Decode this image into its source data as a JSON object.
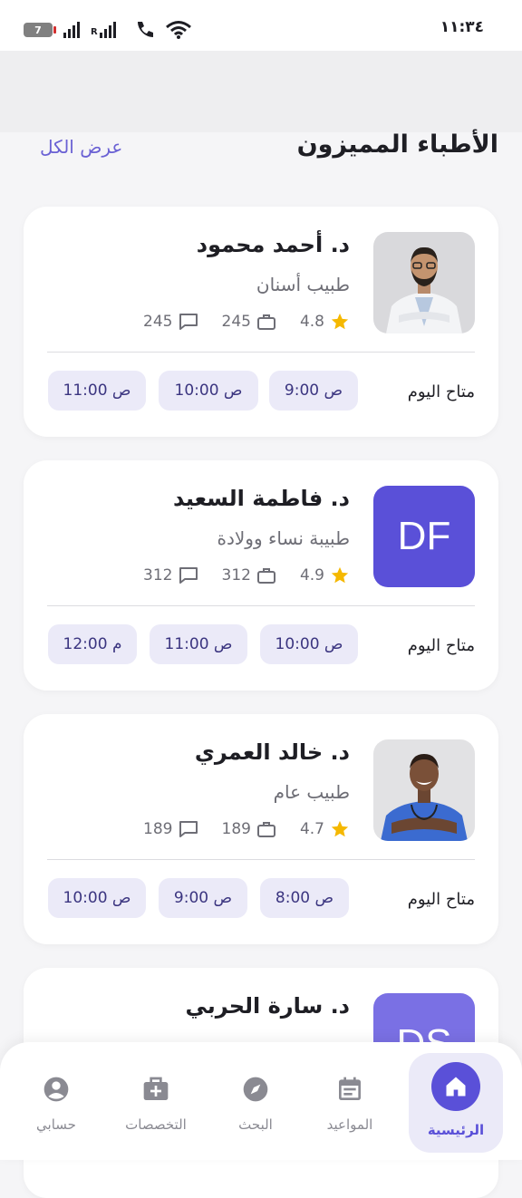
{
  "status_bar": {
    "time": "١١:٣٤",
    "battery": "7",
    "network_label": "R"
  },
  "section": {
    "title": "الأطباء المميزون",
    "view_all": "عرض الكل"
  },
  "doctors": [
    {
      "name": "د. أحمد محمود",
      "specialty": "طبيب أسنان",
      "rating": "4.8",
      "experience": "245",
      "reviews": "245",
      "avatar_type": "photo",
      "available_label": "متاح اليوم",
      "slots": [
        "9:00 ص",
        "10:00 ص",
        "11:00 ص"
      ]
    },
    {
      "name": "د. فاطمة السعيد",
      "specialty": "طبيبة نساء وولادة",
      "rating": "4.9",
      "experience": "312",
      "reviews": "312",
      "initials": "DF",
      "available_label": "متاح اليوم",
      "slots": [
        "10:00 ص",
        "11:00 ص",
        "12:00 م"
      ]
    },
    {
      "name": "د. خالد العمري",
      "specialty": "طبيب عام",
      "rating": "4.7",
      "experience": "189",
      "reviews": "189",
      "avatar_type": "photo",
      "available_label": "متاح اليوم",
      "slots": [
        "8:00 ص",
        "9:00 ص",
        "10:00 ص"
      ]
    },
    {
      "name": "د. سارة الحربي",
      "initials": "DS"
    }
  ],
  "nav": [
    {
      "label": "الرئيسية",
      "icon": "home-icon",
      "active": true
    },
    {
      "label": "المواعيد",
      "icon": "calendar-icon"
    },
    {
      "label": "البحث",
      "icon": "compass-icon"
    },
    {
      "label": "التخصصات",
      "icon": "medical-kit-icon"
    },
    {
      "label": "حسابي",
      "icon": "user-icon"
    }
  ],
  "colors": {
    "primary": "#5a50d8",
    "slot_bg": "#ebeaf8",
    "star": "#f5b800"
  }
}
